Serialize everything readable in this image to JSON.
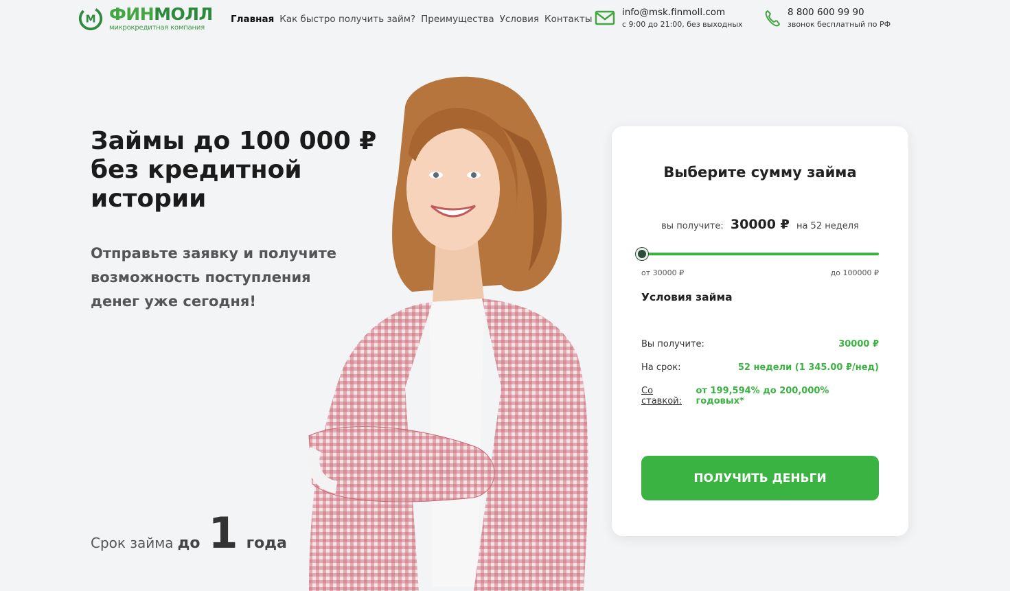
{
  "header": {
    "logo": {
      "name_part1": "ФИН",
      "name_part2": "МОЛЛ",
      "subtitle": "микрокредитная компания"
    },
    "nav": [
      "Главная",
      "Как быстро получить займ?",
      "Преимущества",
      "Условия",
      "Контакты"
    ],
    "email": {
      "address": "info@msk.finmoll.com",
      "hours": "с 9:00 до 21:00, без выходных"
    },
    "phone": {
      "number": "8 800 600 99 90",
      "note": "звонок бесплатный по РФ"
    }
  },
  "hero": {
    "title": "Займы до 100 000 ₽ без кредитной истории",
    "subtitle": "Отправьте заявку и получите возможность поступления денег уже сегодня!",
    "term": {
      "prefix": "Срок займа",
      "do": "до",
      "number": "1",
      "unit": "года"
    }
  },
  "card": {
    "title": "Выберите сумму займа",
    "receive_label": "вы получите:",
    "amount": "30000 ₽",
    "period": "на 52 неделя",
    "slider": {
      "min_label": "от 30000 ₽",
      "max_label": "до 100000 ₽",
      "value": 30000,
      "min": 30000,
      "max": 100000
    },
    "conditions_title": "Условия займа",
    "rows": [
      {
        "label": "Вы получите:",
        "value": "30000 ₽"
      },
      {
        "label": "На срок:",
        "value": "52 недели (1 345.00 ₽/нед)"
      },
      {
        "label": "Со ставкой:",
        "value": "от 199,594% до 200,000% годовых*"
      }
    ],
    "button": "ПОЛУЧИТЬ ДЕНЬГИ"
  },
  "colors": {
    "accent": "#3bb343",
    "knob": "#2d4b3a",
    "background": "#f3f4f6"
  },
  "icons": [
    "logo-mark-icon",
    "mail-icon",
    "phone-icon"
  ]
}
